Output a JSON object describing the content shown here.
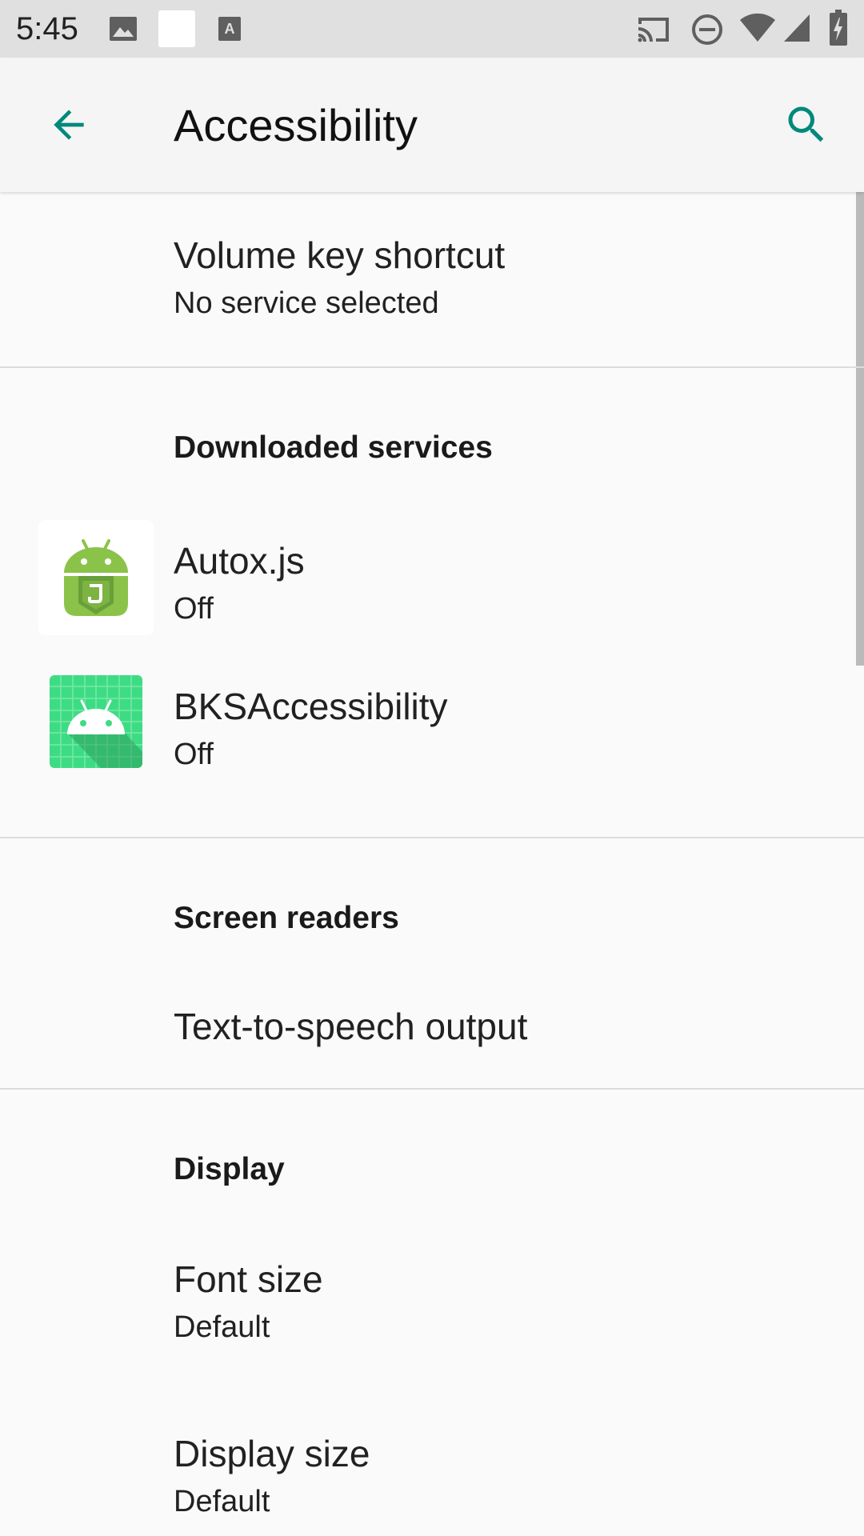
{
  "status_bar": {
    "time": "5:45",
    "icons": [
      "image-icon",
      "white-square-icon",
      "a-notification-icon",
      "cast-icon",
      "do-not-disturb-icon",
      "wifi-icon",
      "cell-signal-icon",
      "battery-icon"
    ]
  },
  "app_bar": {
    "title": "Accessibility",
    "back_icon": "arrow-left-icon",
    "search_icon": "search-icon"
  },
  "colors": {
    "accent": "#00897b",
    "background": "#fafafa",
    "app_bar": "#f5f5f5",
    "status_bar": "#e0e0e0"
  },
  "items": {
    "volume_key": {
      "title": "Volume key shortcut",
      "summary": "No service selected"
    },
    "autox": {
      "title": "Autox.js",
      "summary": "Off",
      "icon": "autoxjs-app-icon"
    },
    "bks": {
      "title": "BKSAccessibility",
      "summary": "Off",
      "icon": "android-app-icon"
    },
    "tts": {
      "title": "Text-to-speech output"
    },
    "font_size": {
      "title": "Font size",
      "summary": "Default"
    },
    "display_size": {
      "title": "Display size",
      "summary": "Default"
    }
  },
  "categories": {
    "downloaded": "Downloaded services",
    "screen_readers": "Screen readers",
    "display": "Display"
  }
}
